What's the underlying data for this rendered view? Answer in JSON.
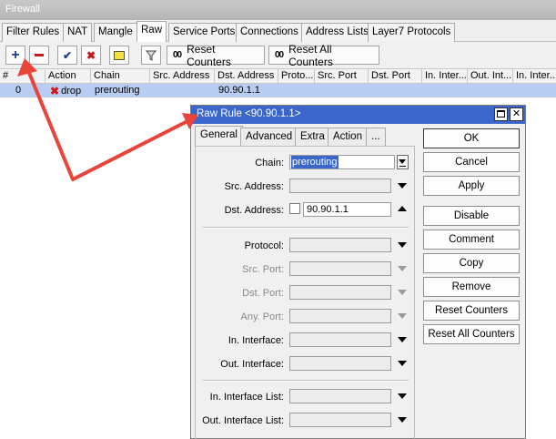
{
  "window": {
    "title": "Firewall"
  },
  "tabs": [
    "Filter Rules",
    "NAT",
    "Mangle",
    "Raw",
    "Service Ports",
    "Connections",
    "Address Lists",
    "Layer7 Protocols"
  ],
  "toolbar": {
    "reset_counters": "Reset Counters",
    "reset_all_counters": "Reset All Counters",
    "counter_icon_text": "00"
  },
  "table": {
    "headers": [
      "#",
      "Action",
      "Chain",
      "Src. Address",
      "Dst. Address",
      "Proto...",
      "Src. Port",
      "Dst. Port",
      "In. Inter...",
      "Out. Int...",
      "In. Inter..."
    ],
    "rows": [
      {
        "num": "0",
        "action": "drop",
        "chain": "prerouting",
        "dst_address": "90.90.1.1"
      }
    ]
  },
  "dialog": {
    "title": "Raw Rule <90.90.1.1>",
    "tabs": [
      "General",
      "Advanced",
      "Extra",
      "Action",
      "..."
    ],
    "fields": {
      "chain_label": "Chain:",
      "chain_value": "prerouting",
      "src_address_label": "Src. Address:",
      "dst_address_label": "Dst. Address:",
      "dst_address_value": "90.90.1.1",
      "protocol_label": "Protocol:",
      "src_port_label": "Src. Port:",
      "dst_port_label": "Dst. Port:",
      "any_port_label": "Any. Port:",
      "in_interface_label": "In. Interface:",
      "out_interface_label": "Out. Interface:",
      "in_interface_list_label": "In. Interface List:",
      "out_interface_list_label": "Out. Interface List:"
    },
    "buttons": {
      "ok": "OK",
      "cancel": "Cancel",
      "apply": "Apply",
      "disable": "Disable",
      "comment": "Comment",
      "copy": "Copy",
      "remove": "Remove",
      "reset_counters": "Reset Counters",
      "reset_all_counters": "Reset All Counters"
    }
  },
  "colors": {
    "selected_row": "#b9cdf3",
    "dialog_title": "#3a67c9",
    "annotation_arrow": "#e8443a"
  }
}
